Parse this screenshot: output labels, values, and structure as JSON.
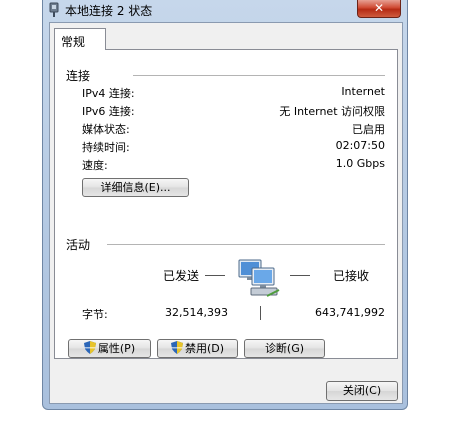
{
  "window": {
    "title": "本地连接 2 状态",
    "close_glyph": "✕"
  },
  "tabs": [
    {
      "label": "常规",
      "selected": true
    }
  ],
  "connection": {
    "group_title": "连接",
    "rows": [
      {
        "label": "IPv4 连接:",
        "value": "Internet"
      },
      {
        "label": "IPv6 连接:",
        "value": "无 Internet 访问权限"
      },
      {
        "label": "媒体状态:",
        "value": "已启用"
      },
      {
        "label": "持续时间:",
        "value": "02:07:50"
      },
      {
        "label": "速度:",
        "value": "1.0 Gbps"
      }
    ],
    "details_button": "详细信息(E)..."
  },
  "activity": {
    "group_title": "活动",
    "sent_label": "已发送",
    "received_label": "已接收",
    "bytes_label": "字节:",
    "bytes_sent": "32,514,393",
    "bytes_received": "643,741,992"
  },
  "buttons": {
    "properties": "属性(P)",
    "disable": "禁用(D)",
    "diagnose": "诊断(G)",
    "close": "关闭(C)"
  },
  "icons": {
    "window": "network-adapter-icon",
    "activity": "network-computers-icon",
    "shield": "uac-shield-icon"
  },
  "colors": {
    "close_button": "#c8432c",
    "window_frame": "#b9cde5",
    "dialog_bg": "#f0f0f0"
  }
}
